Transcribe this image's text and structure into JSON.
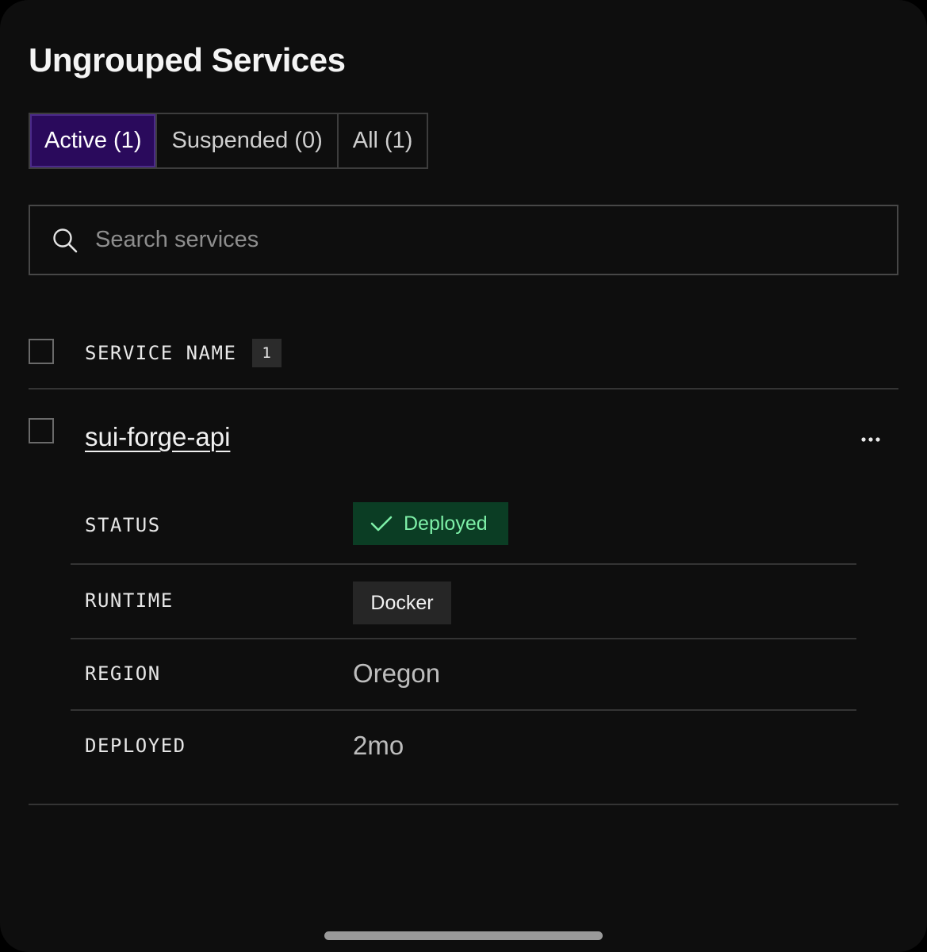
{
  "page": {
    "title": "Ungrouped Services"
  },
  "tabs": [
    {
      "label": "Active (1)",
      "active": true
    },
    {
      "label": "Suspended (0)",
      "active": false
    },
    {
      "label": "All (1)",
      "active": false
    }
  ],
  "search": {
    "placeholder": "Search services",
    "value": "",
    "icon": "search-icon"
  },
  "table": {
    "header": {
      "label": "SERVICE NAME",
      "count": "1"
    },
    "rows": [
      {
        "name": "sui-forge-api",
        "more_icon": "more-horizontal-icon",
        "details": {
          "status_label": "STATUS",
          "status_value": "Deployed",
          "runtime_label": "RUNTIME",
          "runtime_value": "Docker",
          "region_label": "REGION",
          "region_value": "Oregon",
          "deployed_label": "DEPLOYED",
          "deployed_value": "2mo"
        }
      }
    ]
  },
  "colors": {
    "background": "#0e0e0e",
    "active_tab": "#2a0a5c",
    "status_badge_bg": "#0b3d24",
    "status_badge_text": "#7ef0a8",
    "runtime_badge_bg": "#262626"
  }
}
